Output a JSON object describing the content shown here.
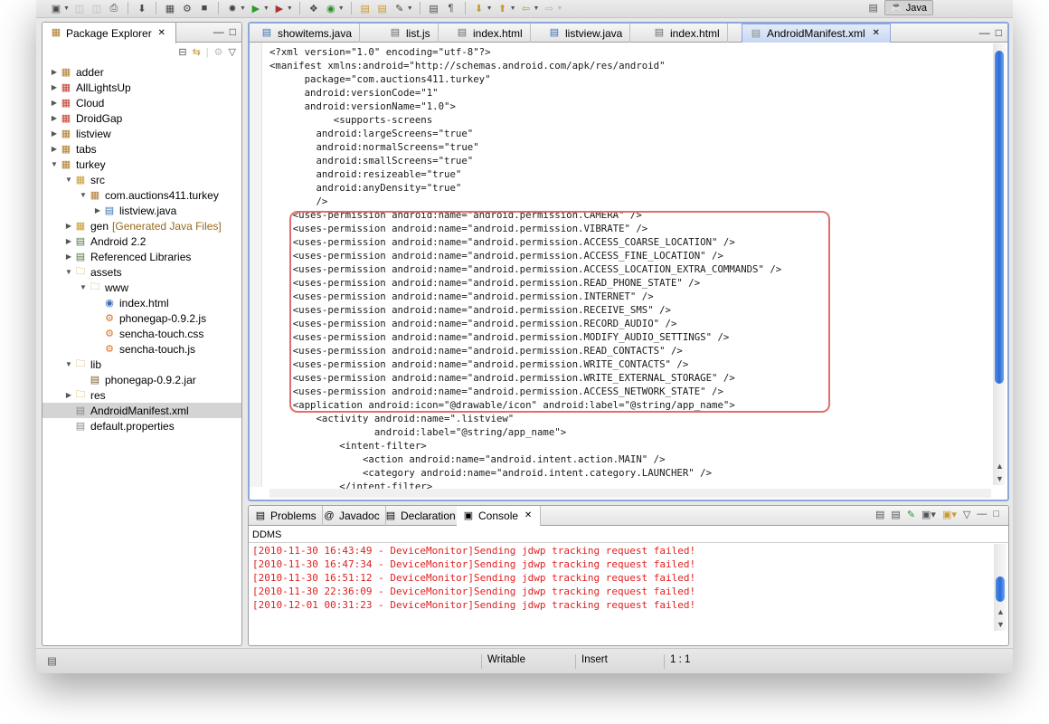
{
  "toolbar": {
    "perspective_label": "Java"
  },
  "package_explorer": {
    "title": "Package Explorer",
    "tree": [
      {
        "label": "adder",
        "icon": "project-icon"
      },
      {
        "label": "AllLightsUp",
        "icon": "project-error-icon"
      },
      {
        "label": "Cloud",
        "icon": "project-error-icon"
      },
      {
        "label": "DroidGap",
        "icon": "project-error-icon"
      },
      {
        "label": "listview",
        "icon": "project-icon"
      },
      {
        "label": "tabs",
        "icon": "project-icon"
      },
      {
        "label": "turkey",
        "icon": "project-icon"
      },
      {
        "label": "src",
        "icon": "source-folder-icon"
      },
      {
        "label": "com.auctions411.turkey",
        "icon": "package-icon"
      },
      {
        "label": "listview.java",
        "icon": "java-file-icon"
      },
      {
        "label": "gen",
        "suffix": "[Generated Java Files]",
        "icon": "source-folder-icon"
      },
      {
        "label": "Android 2.2",
        "icon": "library-icon"
      },
      {
        "label": "Referenced Libraries",
        "icon": "library-icon"
      },
      {
        "label": "assets",
        "icon": "folder-icon"
      },
      {
        "label": "www",
        "icon": "folder-icon"
      },
      {
        "label": "index.html",
        "icon": "html-file-icon"
      },
      {
        "label": "phonegap-0.9.2.js",
        "icon": "js-file-icon"
      },
      {
        "label": "sencha-touch.css",
        "icon": "css-file-icon"
      },
      {
        "label": "sencha-touch.js",
        "icon": "js-file-icon"
      },
      {
        "label": "lib",
        "icon": "folder-icon"
      },
      {
        "label": "phonegap-0.9.2.jar",
        "icon": "jar-file-icon"
      },
      {
        "label": "res",
        "icon": "folder-icon"
      },
      {
        "label": "AndroidManifest.xml",
        "icon": "xml-file-icon"
      },
      {
        "label": "default.properties",
        "icon": "properties-file-icon"
      }
    ]
  },
  "editor": {
    "tabs": [
      {
        "label": "showitems.java",
        "icon": "java-file-icon"
      },
      {
        "label": "list.js",
        "icon": "js-file-icon"
      },
      {
        "label": "index.html",
        "icon": "js-file-icon"
      },
      {
        "label": "listview.java",
        "icon": "java-file-icon"
      },
      {
        "label": "index.html",
        "icon": "html-file-icon"
      },
      {
        "label": "AndroidManifest.xml",
        "icon": "xml-file-icon"
      }
    ],
    "lines": [
      "<?xml version=\"1.0\" encoding=\"utf-8\"?>",
      "<manifest xmlns:android=\"http://schemas.android.com/apk/res/android\"",
      "      package=\"com.auctions411.turkey\"",
      "      android:versionCode=\"1\"",
      "      android:versionName=\"1.0\">",
      "           <supports-screens",
      "        android:largeScreens=\"true\"",
      "        android:normalScreens=\"true\"",
      "        android:smallScreens=\"true\"",
      "        android:resizeable=\"true\"",
      "        android:anyDensity=\"true\"",
      "        />",
      "    <uses-permission android:name=\"android.permission.CAMERA\" />",
      "    <uses-permission android:name=\"android.permission.VIBRATE\" />",
      "    <uses-permission android:name=\"android.permission.ACCESS_COARSE_LOCATION\" />",
      "    <uses-permission android:name=\"android.permission.ACCESS_FINE_LOCATION\" />",
      "    <uses-permission android:name=\"android.permission.ACCESS_LOCATION_EXTRA_COMMANDS\" />",
      "    <uses-permission android:name=\"android.permission.READ_PHONE_STATE\" />",
      "    <uses-permission android:name=\"android.permission.INTERNET\" />",
      "    <uses-permission android:name=\"android.permission.RECEIVE_SMS\" />",
      "    <uses-permission android:name=\"android.permission.RECORD_AUDIO\" />",
      "    <uses-permission android:name=\"android.permission.MODIFY_AUDIO_SETTINGS\" />",
      "    <uses-permission android:name=\"android.permission.READ_CONTACTS\" />",
      "    <uses-permission android:name=\"android.permission.WRITE_CONTACTS\" />",
      "    <uses-permission android:name=\"android.permission.WRITE_EXTERNAL_STORAGE\" />",
      "    <uses-permission android:name=\"android.permission.ACCESS_NETWORK_STATE\" />",
      "    <application android:icon=\"@drawable/icon\" android:label=\"@string/app_name\">",
      "        <activity android:name=\".listview\"",
      "                  android:label=\"@string/app_name\">",
      "            <intent-filter>",
      "                <action android:name=\"android.intent.action.MAIN\" />",
      "                <category android:name=\"android.intent.category.LAUNCHER\" />",
      "            </intent-filter>"
    ]
  },
  "console": {
    "tabs": [
      {
        "label": "Problems",
        "icon": "problems-icon"
      },
      {
        "label": "Javadoc",
        "icon": "javadoc-icon"
      },
      {
        "label": "Declaration",
        "icon": "declaration-icon"
      },
      {
        "label": "Console",
        "icon": "console-icon"
      }
    ],
    "header": "DDMS",
    "log": [
      "[2010-11-30 16:43:49 - DeviceMonitor]Sending jdwp tracking request failed!",
      "[2010-11-30 16:47:34 - DeviceMonitor]Sending jdwp tracking request failed!",
      "[2010-11-30 16:51:12 - DeviceMonitor]Sending jdwp tracking request failed!",
      "[2010-11-30 22:36:09 - DeviceMonitor]Sending jdwp tracking request failed!",
      "[2010-12-01 00:31:23 - DeviceMonitor]Sending jdwp tracking request failed!"
    ],
    "log_color": "#e02020"
  },
  "status": {
    "writable": "Writable",
    "insert": "Insert",
    "position": "1 : 1"
  },
  "colors": {
    "highlight_border": "#e06f6f",
    "editor_active_border": "#8fa7d8",
    "scroll_thumb": "#2d6ad8"
  }
}
